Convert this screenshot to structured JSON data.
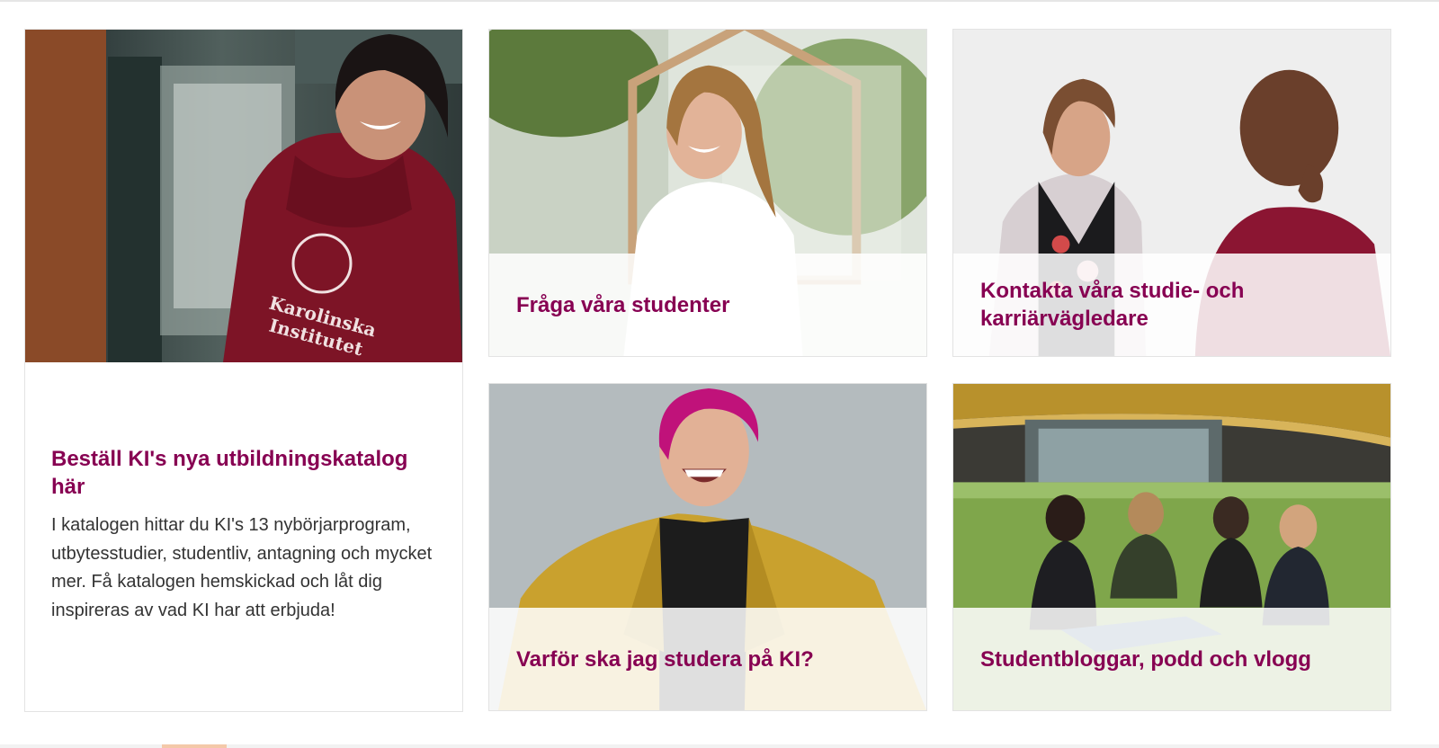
{
  "promo": {
    "title": "Beställ KI's nya utbildningskatalog här",
    "text": "I katalogen hittar du KI's 13 nybörjarprogram, utbytesstudier, studentliv, antagning och mycket mer.  Få katalogen hemskickad och låt dig inspireras av vad KI har att erbjuda!",
    "image_icon": "student-hoodie-photo"
  },
  "cards": [
    {
      "title": "Fråga våra studenter",
      "image_icon": "student-portrait-photo"
    },
    {
      "title": "Kontakta våra studie- och karriärvägledare",
      "image_icon": "counselor-conversation-photo"
    },
    {
      "title": "Varför ska jag studera på KI?",
      "image_icon": "laughing-student-photo"
    },
    {
      "title": "Studentbloggar, podd och vlogg",
      "image_icon": "students-on-lawn-photo"
    }
  ],
  "colors": {
    "accent": "#870052",
    "body_text": "#333333",
    "card_border": "#e3e3e3"
  }
}
